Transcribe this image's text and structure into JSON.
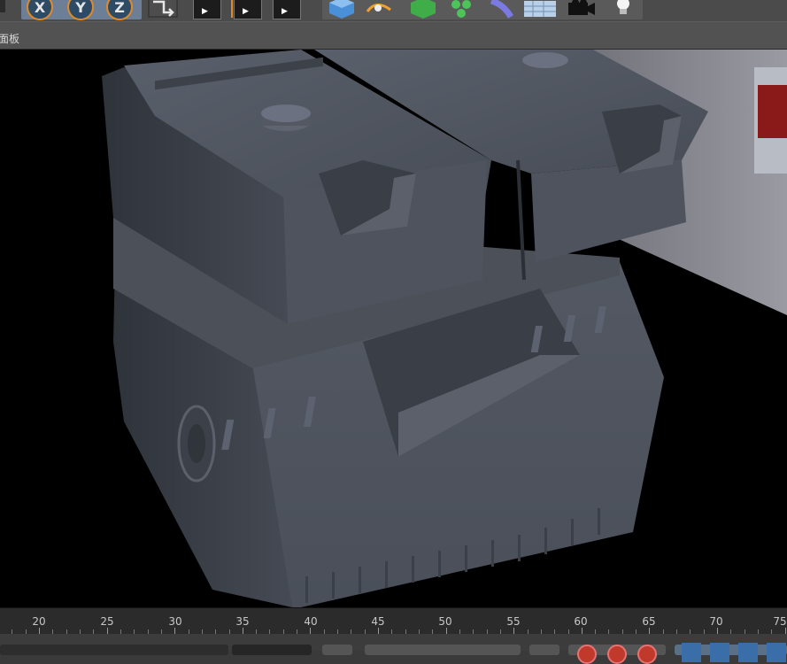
{
  "toolbar": {
    "axis_x": "X",
    "axis_y": "Y",
    "axis_z": "Z"
  },
  "panel": {
    "title": "面板"
  },
  "timeline": {
    "labels": [
      "20",
      "25",
      "30",
      "35",
      "40",
      "45",
      "50",
      "55",
      "60",
      "65",
      "70",
      "75"
    ]
  },
  "colors": {
    "toolbar_bg": "#4b4b4b",
    "viewport_bg": "#000000",
    "model_gray": "#4f5560",
    "accent_orange": "#e08a2a"
  }
}
